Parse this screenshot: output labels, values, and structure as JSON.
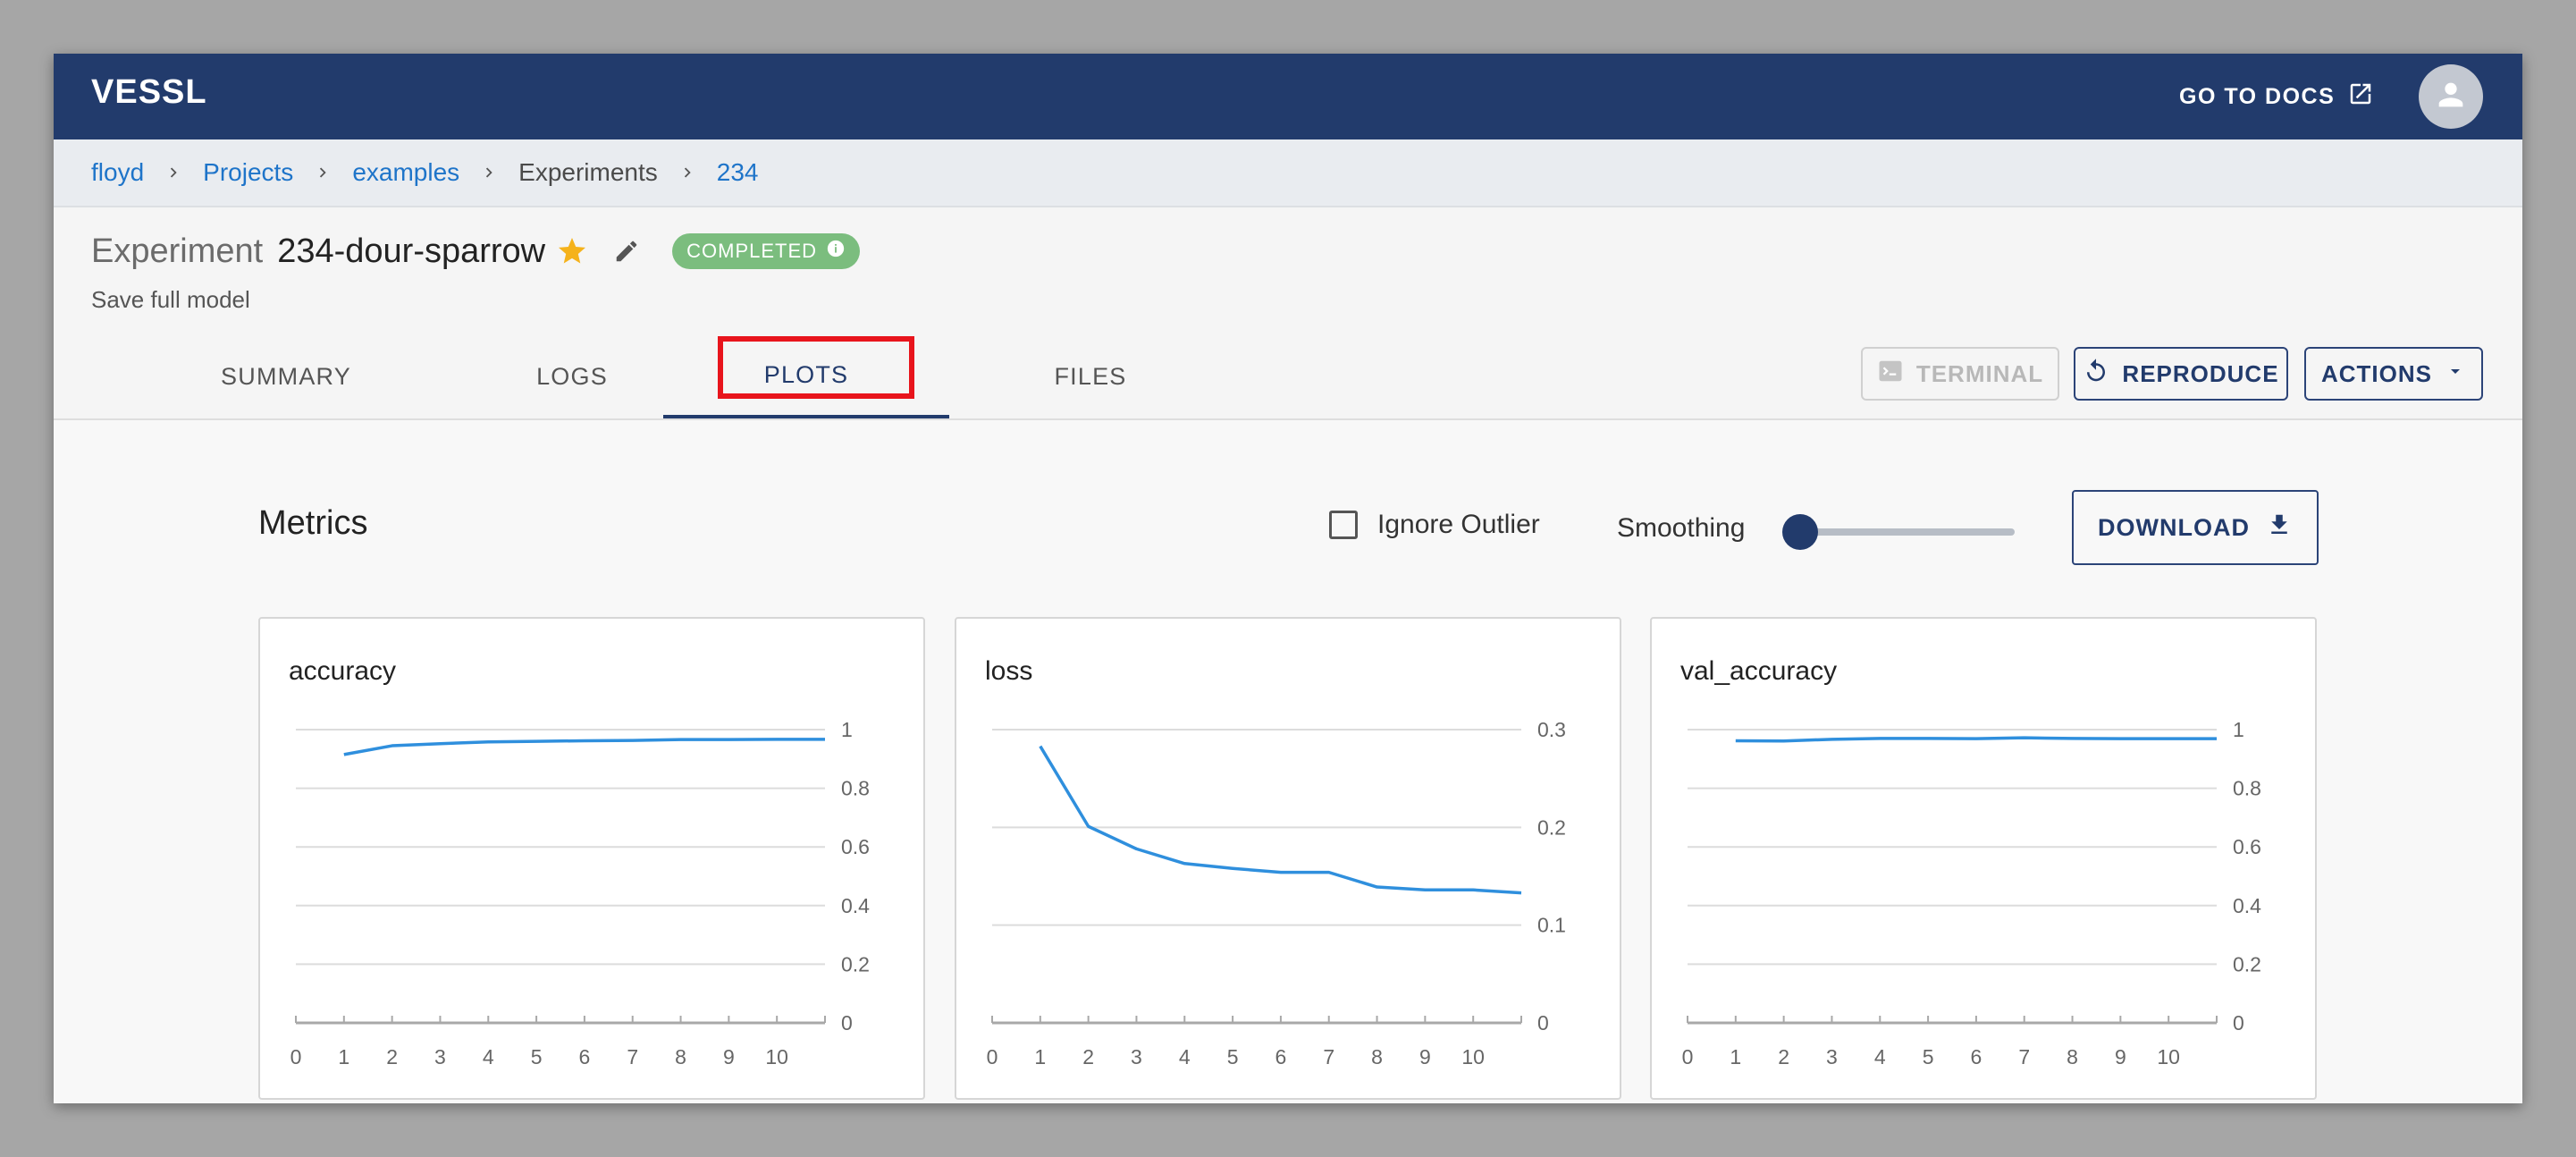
{
  "app": {
    "brand": "VESSL",
    "docs_label": "GO TO DOCS"
  },
  "breadcrumb": [
    {
      "label": "floyd",
      "link": true
    },
    {
      "label": "Projects",
      "link": true
    },
    {
      "label": "examples",
      "link": true
    },
    {
      "label": "Experiments",
      "link": false
    },
    {
      "label": "234",
      "link": true
    }
  ],
  "experiment": {
    "prefix": "Experiment",
    "name": "234-dour-sparrow",
    "status": "COMPLETED",
    "description": "Save full model"
  },
  "tabs": [
    "SUMMARY",
    "LOGS",
    "PLOTS",
    "FILES"
  ],
  "active_tab": "PLOTS",
  "buttons": {
    "terminal": "TERMINAL",
    "reproduce": "REPRODUCE",
    "actions": "ACTIONS",
    "download": "DOWNLOAD"
  },
  "metrics": {
    "title": "Metrics",
    "ignore_outlier_label": "Ignore Outlier",
    "ignore_outlier_checked": false,
    "smoothing_label": "Smoothing",
    "smoothing_value": 0
  },
  "colors": {
    "nav": "#223b6c",
    "line": "#2f8fdd",
    "highlight": "#e8141c",
    "status": "#7bbd7e"
  },
  "chart_data": [
    {
      "type": "line",
      "title": "accuracy",
      "x": [
        1,
        2,
        3,
        4,
        5,
        6,
        7,
        8,
        9,
        10,
        11
      ],
      "series": [
        {
          "values": [
            0.915,
            0.945,
            0.952,
            0.958,
            0.96,
            0.962,
            0.963,
            0.966,
            0.966,
            0.967,
            0.967
          ]
        }
      ],
      "x_ticks": [
        0,
        1,
        2,
        3,
        4,
        5,
        6,
        7,
        8,
        9,
        10
      ],
      "y_ticks": [
        0,
        0.2,
        0.4,
        0.6,
        0.8,
        1
      ],
      "y_tick_labels": [
        "0",
        "0.2",
        "0.4",
        "0.6",
        "0.8",
        "1"
      ],
      "ylim": [
        0,
        1
      ],
      "xlim": [
        0,
        11
      ],
      "grid": true
    },
    {
      "type": "line",
      "title": "loss",
      "x": [
        1,
        2,
        3,
        4,
        5,
        6,
        7,
        8,
        9,
        10,
        11
      ],
      "series": [
        {
          "values": [
            0.283,
            0.201,
            0.178,
            0.163,
            0.158,
            0.154,
            0.154,
            0.139,
            0.136,
            0.136,
            0.133
          ]
        }
      ],
      "x_ticks": [
        0,
        1,
        2,
        3,
        4,
        5,
        6,
        7,
        8,
        9,
        10
      ],
      "y_ticks": [
        0,
        0.1,
        0.2,
        0.3
      ],
      "y_tick_labels": [
        "0",
        "0.1",
        "0.2",
        "0.3"
      ],
      "ylim": [
        0,
        0.3
      ],
      "xlim": [
        0,
        11
      ],
      "grid": true
    },
    {
      "type": "line",
      "title": "val_accuracy",
      "x": [
        1,
        2,
        3,
        4,
        5,
        6,
        7,
        8,
        9,
        10,
        11
      ],
      "series": [
        {
          "values": [
            0.962,
            0.961,
            0.967,
            0.97,
            0.97,
            0.969,
            0.972,
            0.97,
            0.969,
            0.969,
            0.969
          ]
        }
      ],
      "x_ticks": [
        0,
        1,
        2,
        3,
        4,
        5,
        6,
        7,
        8,
        9,
        10
      ],
      "y_ticks": [
        0,
        0.2,
        0.4,
        0.6,
        0.8,
        1
      ],
      "y_tick_labels": [
        "0",
        "0.2",
        "0.4",
        "0.6",
        "0.8",
        "1"
      ],
      "ylim": [
        0,
        1
      ],
      "xlim": [
        0,
        11
      ],
      "grid": true
    }
  ]
}
